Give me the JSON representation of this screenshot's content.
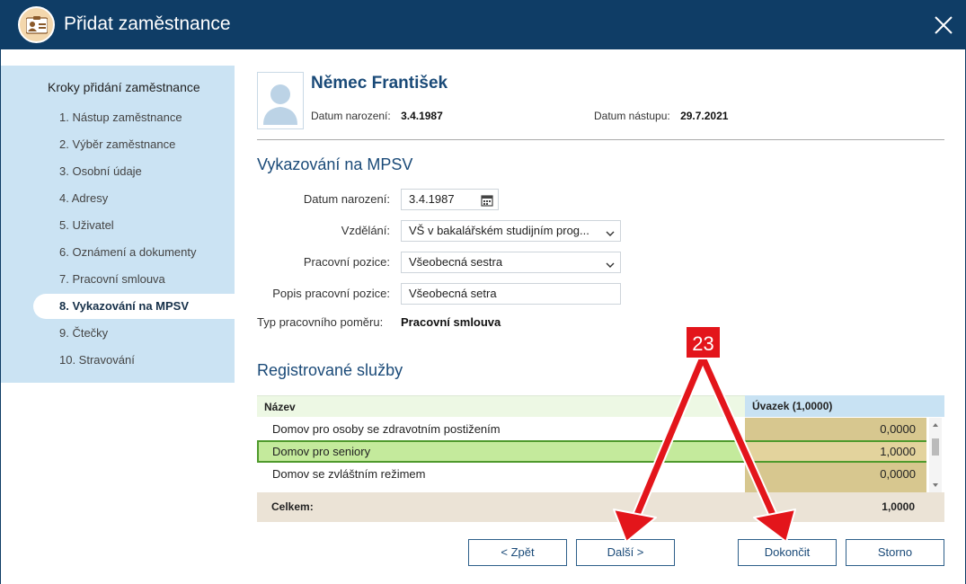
{
  "window": {
    "title": "Přidat zaměstnance"
  },
  "sidebar": {
    "title": "Kroky přidání zaměstnance",
    "steps": [
      "1. Nástup zaměstnance",
      "2. Výběr zaměstnance",
      "3. Osobní údaje",
      "4. Adresy",
      "5. Uživatel",
      "6. Oznámení a dokumenty",
      "7. Pracovní smlouva",
      "8. Vykazování na MPSV",
      "9. Čtečky",
      "10. Stravování"
    ],
    "active_index": 7
  },
  "employee": {
    "name": "Němec František",
    "birth_label": "Datum narození:",
    "birth_value": "3.4.1987",
    "start_label": "Datum nástupu:",
    "start_value": "29.7.2021"
  },
  "section_mpsv": {
    "title": "Vykazování na MPSV",
    "birth_date_label": "Datum narození:",
    "birth_date_value": "3.4.1987",
    "education_label": "Vzdělání:",
    "education_value": "VŠ v bakalářském studijním prog...",
    "position_label": "Pracovní pozice:",
    "position_value": "Všeobecná sestra",
    "position_desc_label": "Popis pracovní pozice:",
    "position_desc_value": "Všeobecná setra",
    "employment_type_label": "Typ pracovního poměru:",
    "employment_type_value": "Pracovní smlouva"
  },
  "services": {
    "title": "Registrované služby",
    "col_name": "Název",
    "col_load": "Úvazek (1,0000)",
    "rows": [
      {
        "name": "Domov pro osoby se zdravotním postižením",
        "load": "0,0000"
      },
      {
        "name": "Domov pro seniory",
        "load": "1,0000"
      },
      {
        "name": "Domov se zvláštním režimem",
        "load": "0,0000"
      }
    ],
    "selected_index": 1,
    "total_label": "Celkem:",
    "total_value": "1,0000"
  },
  "buttons": {
    "back": "< Zpět",
    "next": "Další >",
    "finish": "Dokončit",
    "cancel": "Storno"
  },
  "annotation": {
    "badge": "23",
    "color": "#e3151b"
  }
}
